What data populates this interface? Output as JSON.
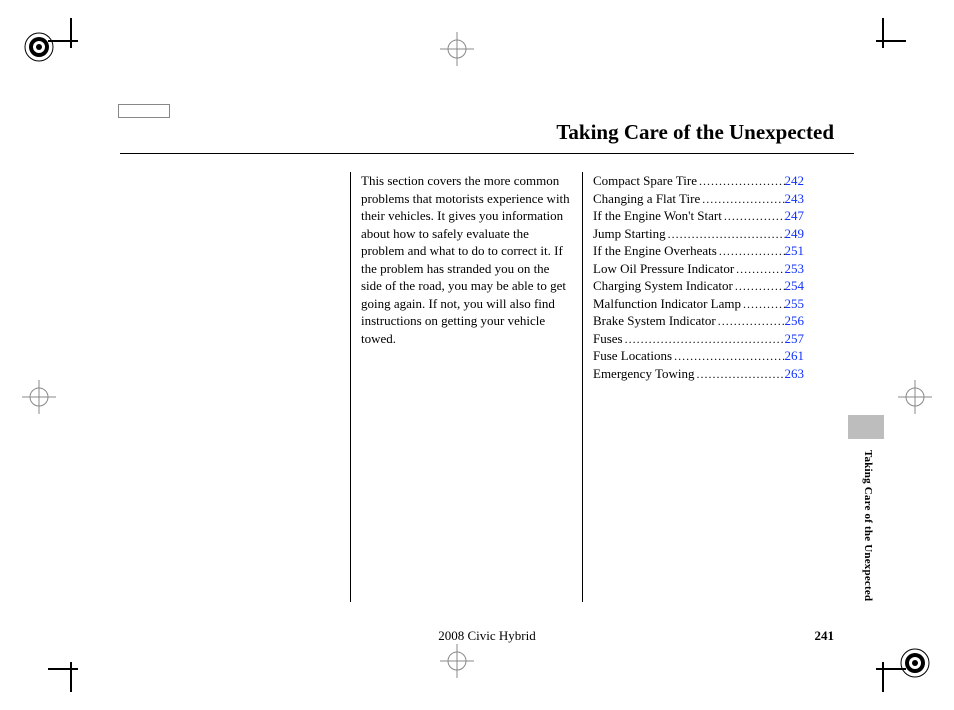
{
  "title": "Taking Care of the Unexpected",
  "side_label": "Taking Care of the Unexpected",
  "intro": "This section covers the more common problems that motorists experience with their vehicles. It gives you information about how to safely evaluate the problem and what to do to correct it. If the problem has stranded you on the side of the road, you may be able to get going again. If not, you will also find instructions on getting your vehicle towed.",
  "toc": [
    {
      "label": "Compact Spare Tire",
      "page": "242"
    },
    {
      "label": "Changing a Flat Tire",
      "page": "243"
    },
    {
      "label": "If the Engine Won't Start",
      "page": "247"
    },
    {
      "label": "Jump Starting",
      "page": "249"
    },
    {
      "label": "If the Engine Overheats",
      "page": "251"
    },
    {
      "label": "Low Oil Pressure Indicator",
      "page": "253"
    },
    {
      "label": "Charging System Indicator",
      "page": "254"
    },
    {
      "label": "Malfunction Indicator Lamp",
      "page": "255"
    },
    {
      "label": "Brake System Indicator",
      "page": "256"
    },
    {
      "label": "Fuses",
      "page": "257"
    },
    {
      "label": "Fuse Locations",
      "page": "261"
    },
    {
      "label": "Emergency Towing",
      "page": "263"
    }
  ],
  "footer": {
    "model": "2008  Civic  Hybrid",
    "page_number": "241"
  }
}
